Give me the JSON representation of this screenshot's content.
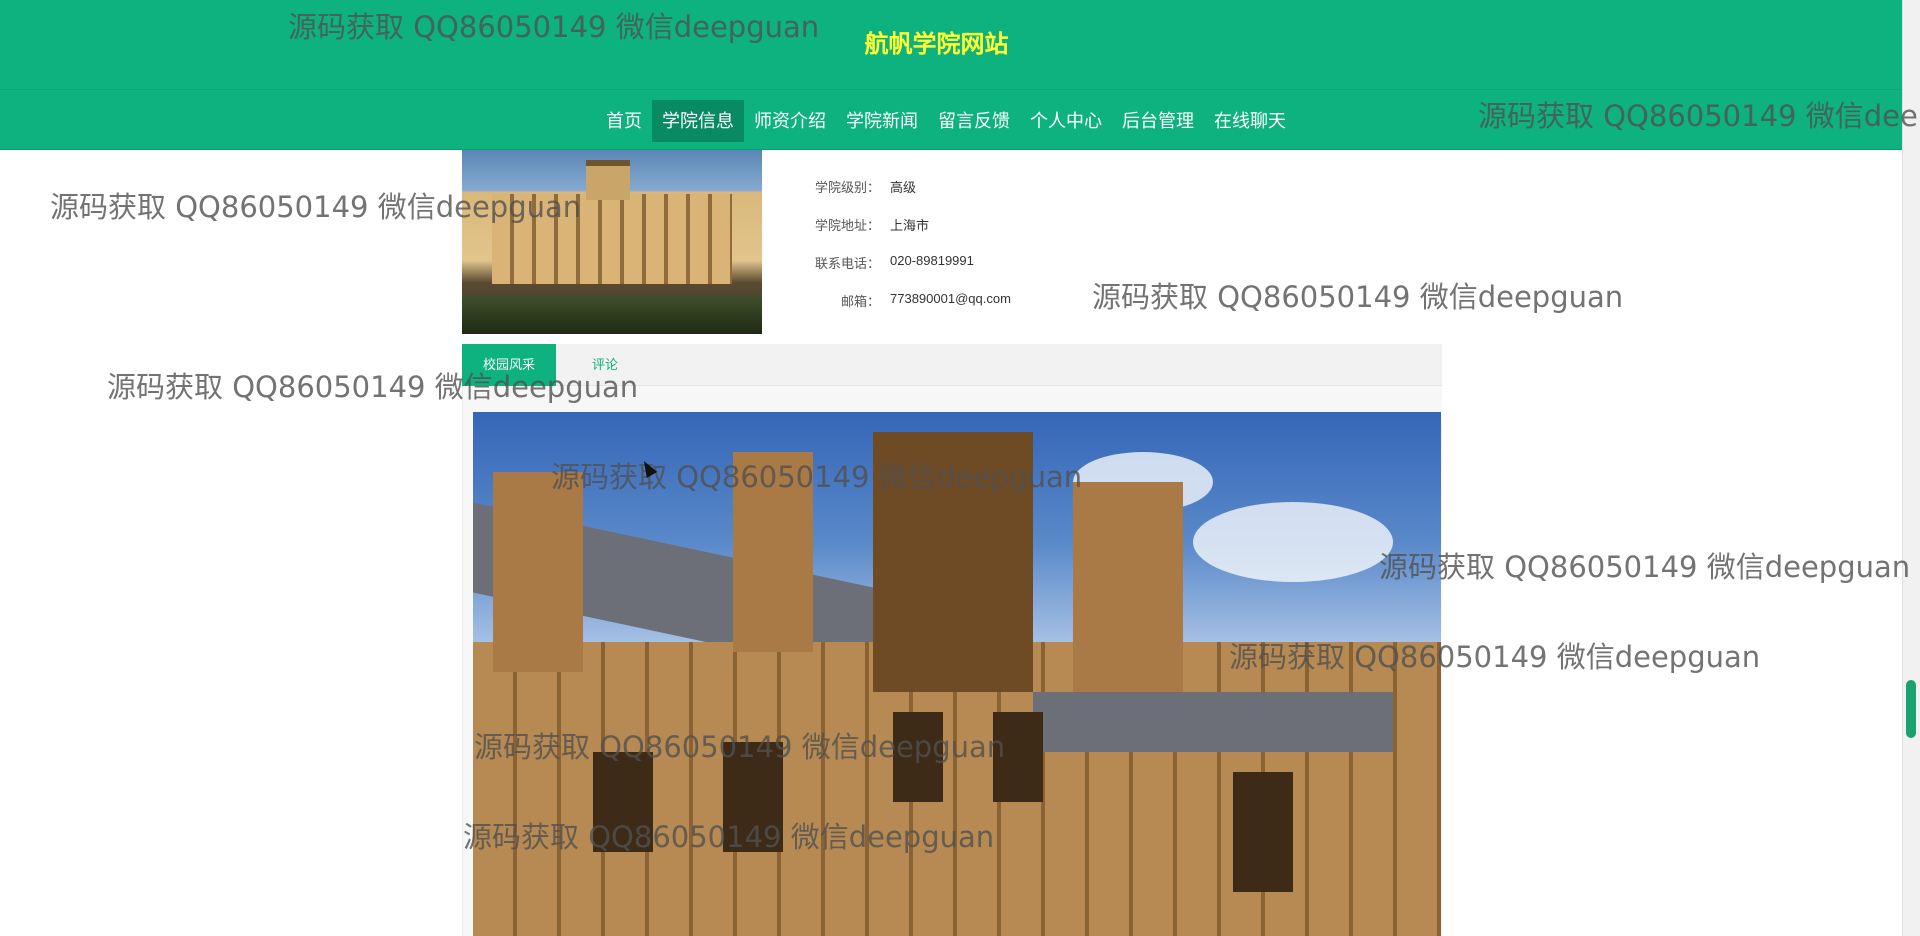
{
  "header": {
    "site_title": "航帆学院网站",
    "nav": [
      "首页",
      "学院信息",
      "师资介绍",
      "学院新闻",
      "留言反馈",
      "个人中心",
      "后台管理",
      "在线聊天"
    ],
    "active_nav": "学院信息"
  },
  "details": [
    {
      "label": "学院级别：",
      "value": "高级"
    },
    {
      "label": "学院地址：",
      "value": "上海市"
    },
    {
      "label": "联系电话：",
      "value": "020-89819991"
    },
    {
      "label": "邮箱：",
      "value": "773890001@qq.com"
    }
  ],
  "tabs": {
    "campus": "校园风采",
    "comments": "评论"
  },
  "watermark": "源码获取 QQ86050149 微信deepguan",
  "colors": {
    "brand": "#0db27e",
    "title": "#ffff33",
    "active_nav": "#088a62"
  },
  "icons": [
    "mouse-cursor-icon"
  ]
}
